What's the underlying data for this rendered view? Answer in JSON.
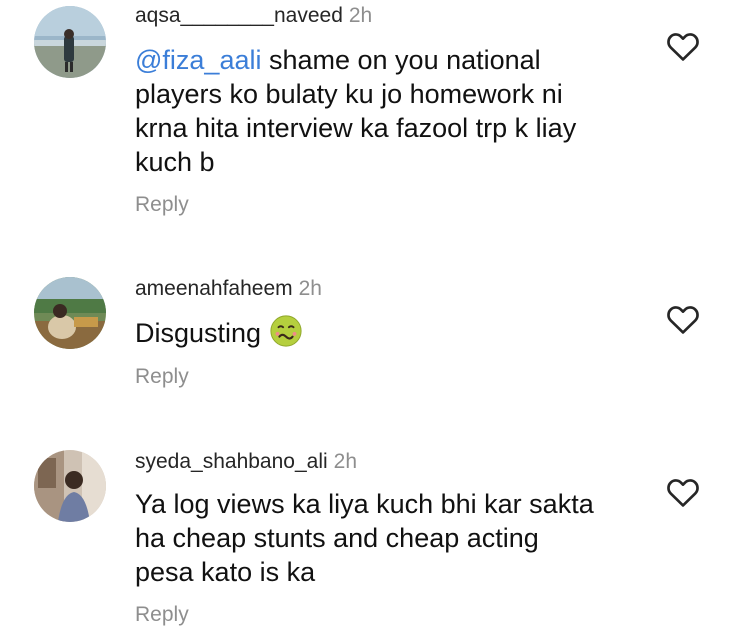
{
  "comments": [
    {
      "username": "aqsa________naveed",
      "time": "2h",
      "mention": "@fiza_aali",
      "text": " shame on you national\nplayers ko bulaty ku jo homework ni\nkrna hita interview ka fazool trp k liay\nkuch b",
      "reply": "Reply"
    },
    {
      "username": "ameenahfaheem",
      "time": "2h",
      "text": "Disgusting",
      "emoji": "nauseated-face",
      "reply": "Reply"
    },
    {
      "username": "syeda_shahbano_ali",
      "time": "2h",
      "text": "Ya log views ka liya kuch bhi kar sakta\nha cheap stunts and cheap acting\npesa kato is ka",
      "reply": "Reply"
    }
  ],
  "icons": {
    "like": "heart-outline-icon"
  },
  "colors": {
    "mention": "#3b7ed8",
    "muted": "#8e8e8e"
  }
}
